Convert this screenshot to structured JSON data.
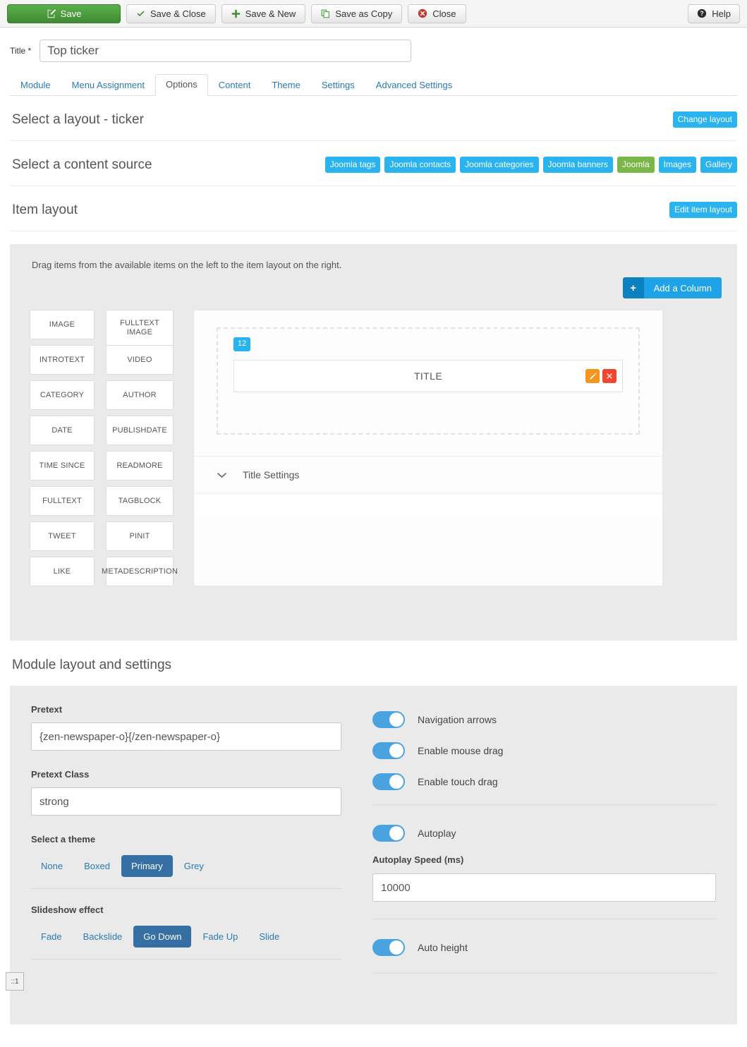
{
  "toolbar": {
    "buttons": [
      {
        "label": "Save",
        "icon": "edit-icon",
        "style": "save"
      },
      {
        "label": "Save & Close",
        "icon": "check-icon",
        "style": "default"
      },
      {
        "label": "Save & New",
        "icon": "plus-icon",
        "style": "default"
      },
      {
        "label": "Save as Copy",
        "icon": "copy-icon",
        "style": "default"
      },
      {
        "label": "Close",
        "icon": "close-circle-icon",
        "style": "default"
      }
    ],
    "help_label": "Help",
    "help_icon": "question-circle-icon"
  },
  "title_field": {
    "label": "Title *",
    "value": "Top ticker",
    "placeholder": "Title"
  },
  "tabs": [
    {
      "label": "Module",
      "active": false
    },
    {
      "label": "Menu Assignment",
      "active": false
    },
    {
      "label": "Options",
      "active": true
    },
    {
      "label": "Content",
      "active": false
    },
    {
      "label": "Theme",
      "active": false
    },
    {
      "label": "Settings",
      "active": false
    },
    {
      "label": "Advanced Settings",
      "active": false
    }
  ],
  "sections": {
    "layout": {
      "title": "Select a layout - ticker",
      "action_label": "Change layout"
    },
    "content_source": {
      "title": "Select a content source",
      "options": [
        {
          "label": "Joomla tags",
          "selected": false
        },
        {
          "label": "Joomla contacts",
          "selected": false
        },
        {
          "label": "Joomla categories",
          "selected": false
        },
        {
          "label": "Joomla banners",
          "selected": false
        },
        {
          "label": "Joomla",
          "selected": true
        },
        {
          "label": "Images",
          "selected": false
        },
        {
          "label": "Gallery",
          "selected": false
        }
      ]
    },
    "item_layout": {
      "title": "Item layout",
      "action_label": "Edit item layout"
    }
  },
  "item_layout_panel": {
    "drag_hint": "Drag items from the available items on the left to the item layout on the right.",
    "add_column_label": "Add a Column",
    "available_items": [
      "IMAGE",
      "FULLTEXT IMAGE",
      "INTROTEXT",
      "VIDEO",
      "CATEGORY",
      "AUTHOR",
      "DATE",
      "PUBLISHDATE",
      "TIME SINCE",
      "READMORE",
      "FULLTEXT",
      "TAGBLOCK",
      "TWEET",
      "PINIT",
      "LIKE",
      "METADESCRIPTION"
    ],
    "column_width": "12",
    "placed_item": "TITLE",
    "edit_icon": "pencil-icon",
    "delete_icon": "x-icon",
    "settings_toggle_label": "Title Settings",
    "settings_chevron": "chevron-down-icon"
  },
  "module_settings": {
    "heading": "Module layout and settings",
    "pretext": {
      "label": "Pretext",
      "value": "{zen-newspaper-o}{/zen-newspaper-o}",
      "placeholder": "Pretext"
    },
    "pretext_class": {
      "label": "Pretext Class",
      "value": "strong",
      "placeholder": "Pretext Class"
    },
    "theme": {
      "label": "Select a theme",
      "options": [
        {
          "label": "None",
          "active": false
        },
        {
          "label": "Boxed",
          "active": false
        },
        {
          "label": "Primary",
          "active": true
        },
        {
          "label": "Grey",
          "active": false
        }
      ]
    },
    "slideshow_effect": {
      "label": "Slideshow effect",
      "options": [
        {
          "label": "Fade",
          "active": false
        },
        {
          "label": "Backslide",
          "active": false
        },
        {
          "label": "Go Down",
          "active": true
        },
        {
          "label": "Fade Up",
          "active": false
        },
        {
          "label": "Slide",
          "active": false
        }
      ]
    },
    "toggles_group_one": [
      {
        "label": "Navigation arrows",
        "on": true
      },
      {
        "label": "Enable mouse drag",
        "on": true
      },
      {
        "label": "Enable touch drag",
        "on": true
      }
    ],
    "autoplay": {
      "label": "Autoplay",
      "on": true
    },
    "autoplay_speed": {
      "label": "Autoplay Speed (ms)",
      "value": "10000",
      "placeholder": "Autoplay Speed"
    },
    "auto_height": {
      "label": "Auto height",
      "on": true
    }
  },
  "origin_chip": {
    "text": "::1"
  },
  "colors": {
    "badge_blue": "#29b3ef",
    "badge_green": "#7ab648",
    "save_green": "#3f8a33",
    "accent_blue": "#1fa3e8",
    "active_btn_blue": "#356fa3",
    "edit_orange": "#f7941e",
    "delete_red": "#f4462e",
    "link_blue": "#2a7ab0",
    "toggle_on": "#4aa3df"
  }
}
